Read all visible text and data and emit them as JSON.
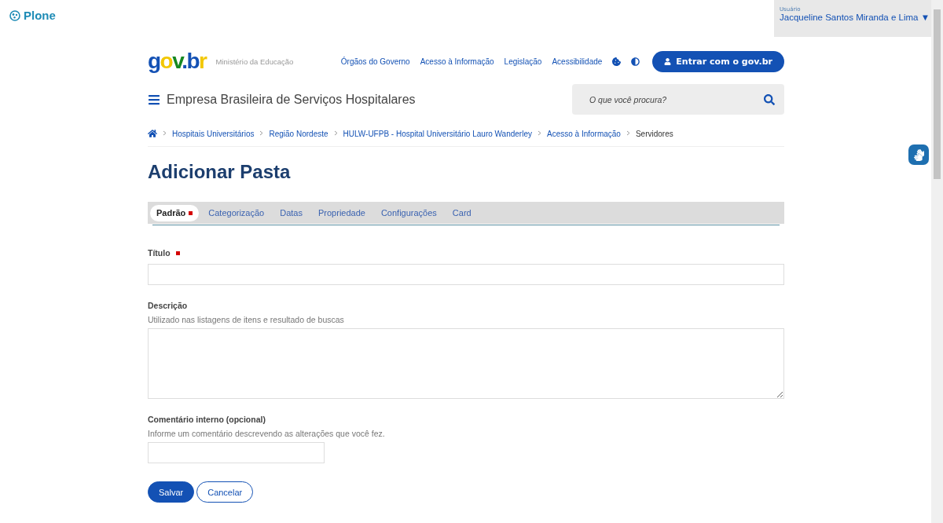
{
  "plone_logo": {
    "label": "Plone"
  },
  "user_menu": {
    "caption": "Usuário",
    "name": "Jacqueline Santos Miranda e Lima",
    "caret": "▼"
  },
  "header": {
    "logo": "gov.br",
    "ministry": "Ministério da Educação",
    "links": [
      "Órgãos do Governo",
      "Acesso à Informação",
      "Legislação",
      "Acessibilidade"
    ],
    "login_button": "Entrar com o gov.br"
  },
  "site": {
    "title": "Empresa Brasileira de Serviços Hospitalares",
    "search_placeholder": "O que você procura?"
  },
  "breadcrumb": [
    {
      "label": "Hospitais Universitários",
      "current": false
    },
    {
      "label": "Região Nordeste",
      "current": false
    },
    {
      "label": "HULW-UFPB - Hospital Universitário Lauro Wanderley",
      "current": false
    },
    {
      "label": "Acesso à Informação",
      "current": false
    },
    {
      "label": "Servidores",
      "current": true
    }
  ],
  "page_title": "Adicionar Pasta",
  "tabs": [
    {
      "label": "Padrão",
      "selected": true,
      "required": true
    },
    {
      "label": "Categorização",
      "selected": false,
      "required": false
    },
    {
      "label": "Datas",
      "selected": false,
      "required": false
    },
    {
      "label": "Propriedade",
      "selected": false,
      "required": false
    },
    {
      "label": "Configurações",
      "selected": false,
      "required": false
    },
    {
      "label": "Card",
      "selected": false,
      "required": false
    }
  ],
  "fields": [
    {
      "kind": "text",
      "label": "Título",
      "required": true
    },
    {
      "kind": "textarea",
      "label": "Descrição",
      "required": false,
      "help": "Utilizado nas listagens de itens e resultado de buscas"
    },
    {
      "kind": "short",
      "label": "Comentário interno (opcional)",
      "required": false,
      "help": "Informe um comentário descrevendo as alterações que você fez."
    }
  ],
  "buttons": [
    {
      "kind": "primary",
      "label": "Salvar"
    },
    {
      "kind": "secondary",
      "label": "Cancelar"
    }
  ]
}
